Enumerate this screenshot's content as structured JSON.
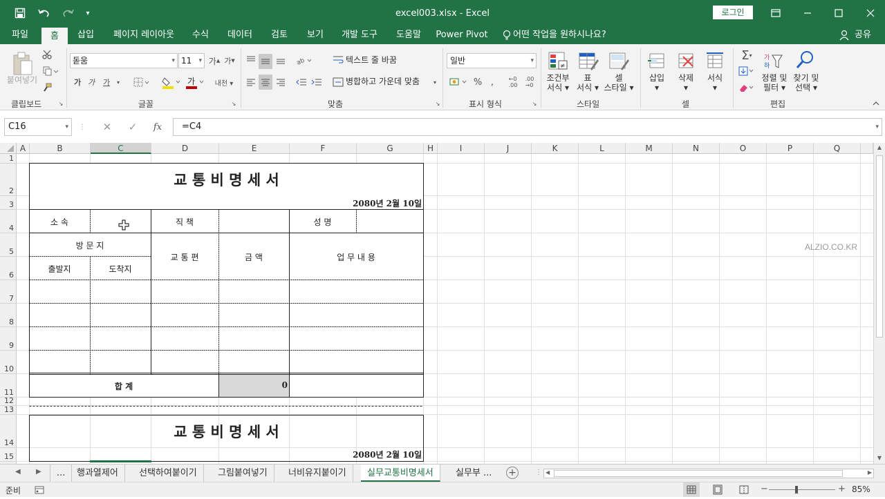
{
  "titlebar": {
    "title": "excel003.xlsx - Excel",
    "login": "로그인",
    "save_icon": "save-icon",
    "undo_icon": "undo-icon",
    "redo_icon": "redo-icon"
  },
  "ribbon_tabs": [
    "파일",
    "홈",
    "삽입",
    "페이지 레이아웃",
    "수식",
    "데이터",
    "검토",
    "보기",
    "개발 도구",
    "도움말",
    "Power Pivot"
  ],
  "tell_me": "어떤 작업을 원하시나요?",
  "share": "공유",
  "ribbon": {
    "clipboard": {
      "paste": "붙여넣기",
      "label": "클립보드"
    },
    "font": {
      "name": "돋움",
      "size": "11",
      "bold": "가",
      "italic": "가",
      "underline": "가",
      "label": "글꼴"
    },
    "alignment": {
      "wrap": "텍스트 줄 바꿈",
      "merge": "병합하고 가운데 맞춤",
      "label": "맞춤"
    },
    "number": {
      "format": "일반",
      "label": "표시 형식"
    },
    "styles": {
      "conditional_1": "조건부",
      "conditional_2": "서식",
      "table_1": "표",
      "table_2": "서식",
      "cell_1": "셀",
      "cell_2": "스타일",
      "label": "스타일"
    },
    "cells": {
      "insert": "삽입",
      "delete": "삭제",
      "format": "서식",
      "label": "셀"
    },
    "editing": {
      "sort_1": "정렬 및",
      "sort_2": "필터",
      "find_1": "찾기 및",
      "find_2": "선택",
      "label": "편집"
    }
  },
  "formula_bar": {
    "name_box": "C16",
    "formula": "=C4",
    "fx": "fx"
  },
  "columns": [
    "A",
    "B",
    "C",
    "D",
    "E",
    "F",
    "G",
    "H",
    "I",
    "J",
    "K",
    "L",
    "M",
    "N",
    "O",
    "P",
    "Q"
  ],
  "rows": [
    "1",
    "2",
    "3",
    "4",
    "5",
    "6",
    "7",
    "8",
    "9",
    "10",
    "11",
    "12",
    "13",
    "14",
    "15"
  ],
  "form1": {
    "title": "교 통 비 명 세 서",
    "date": "2080년 2월 10일",
    "affiliation": "소  속",
    "position": "직  책",
    "name": "성  명",
    "visit": "방 문 지",
    "departure": "출발지",
    "arrival": "도착지",
    "transport": "교 통 편",
    "amount": "금  액",
    "work": "업 무 내 용",
    "total": "합       계",
    "total_value": "0"
  },
  "form2": {
    "title": "교 통 비 명 세 서",
    "date": "2080년 2월 10일"
  },
  "watermark": "ALZIO.CO.KR",
  "sheet_tabs": [
    "...",
    "행과열제어",
    "선택하여붙이기",
    "그림붙여넣기",
    "너비유지붙이기",
    "실무교통비명세서",
    "실무부 ..."
  ],
  "active_sheet": "실무교통비명세서",
  "status": {
    "ready": "준비",
    "zoom": "85%"
  }
}
